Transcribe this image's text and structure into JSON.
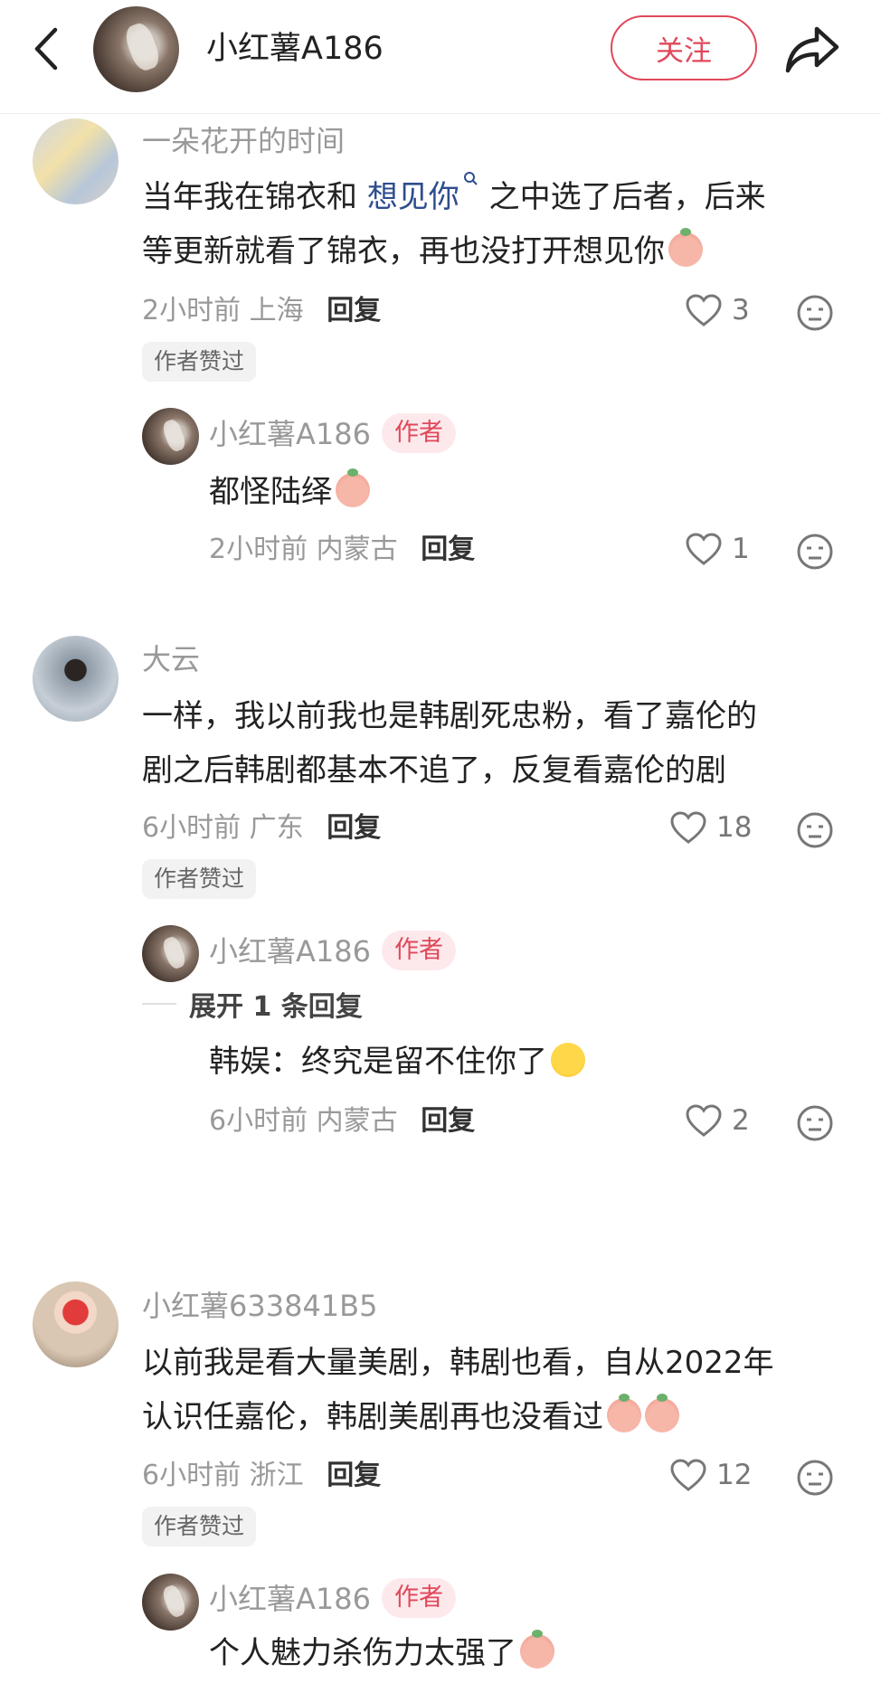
{
  "header": {
    "username": "小红薯A186",
    "follow_label": "关注"
  },
  "comments": [
    {
      "username": "一朵花开的时间",
      "text_line1_a": "当年我在锦衣和",
      "text_link": "想见你",
      "text_line1_b": "之中选了后者，后来",
      "text_line2": "等更新就看了锦衣，再也没打开想见你",
      "time": "2小时前",
      "location": "上海",
      "reply_label": "回复",
      "likes": "3",
      "badge": "作者赞过",
      "reply": {
        "username": "小红薯A186",
        "tag": "作者",
        "text": "都怪陆绎",
        "time": "2小时前",
        "location": "内蒙古",
        "reply_label": "回复",
        "likes": "1"
      }
    },
    {
      "username": "大云",
      "text_line1": "一样，我以前我也是韩剧死忠粉，看了嘉伦的",
      "text_line2": "剧之后韩剧都基本不追了，反复看嘉伦的剧",
      "time": "6小时前",
      "location": "广东",
      "reply_label": "回复",
      "likes": "18",
      "badge": "作者赞过",
      "reply": {
        "username": "小红薯A186",
        "tag": "作者",
        "text": "韩娱：终究是留不住你了",
        "time": "6小时前",
        "location": "内蒙古",
        "reply_label": "回复",
        "likes": "2"
      },
      "expand_label": "展开 1 条回复"
    },
    {
      "username": "小红薯633841B5",
      "text_line1": "以前我是看大量美剧，韩剧也看，自从2022年",
      "text_line2": "认识任嘉伦，韩剧美剧再也没看过",
      "time": "6小时前",
      "location": "浙江",
      "reply_label": "回复",
      "likes": "12",
      "badge": "作者赞过",
      "reply": {
        "username": "小红薯A186",
        "tag": "作者",
        "text": "个人魅力杀伤力太强了"
      }
    }
  ],
  "colors": {
    "accent": "#e0485a",
    "link": "#2e4d8f",
    "meta": "#999999"
  }
}
